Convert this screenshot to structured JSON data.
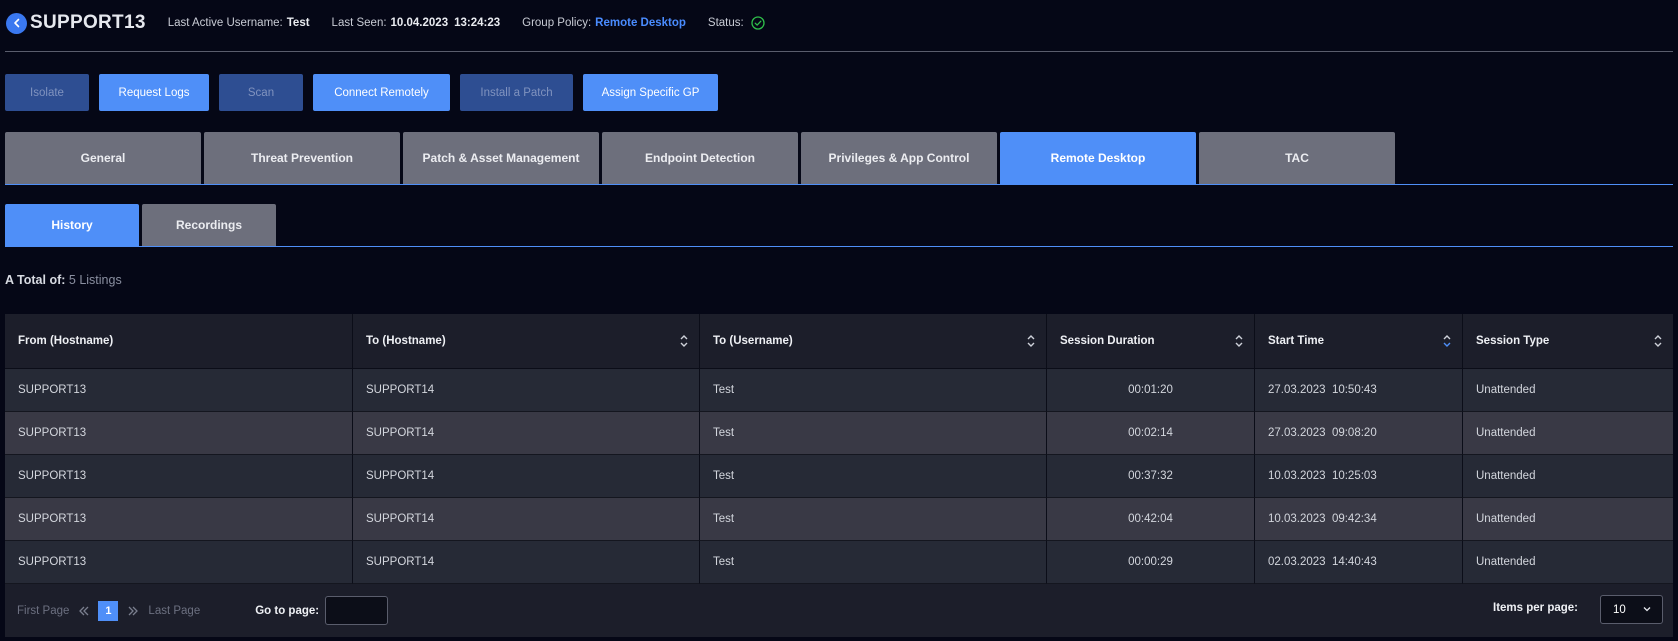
{
  "header": {
    "hostname": "SUPPORT13",
    "last_active_label": "Last Active Username:",
    "last_active_value": "Test",
    "last_seen_label": "Last Seen:",
    "last_seen_date": "10.04.2023",
    "last_seen_time": "13:24:23",
    "group_policy_label": "Group Policy:",
    "group_policy_value": "Remote Desktop",
    "status_label": "Status:",
    "status_icon": "check-circle-icon"
  },
  "actions": [
    {
      "label": "Isolate",
      "enabled": false
    },
    {
      "label": "Request Logs",
      "enabled": true
    },
    {
      "label": "Scan",
      "enabled": false
    },
    {
      "label": "Connect Remotely",
      "enabled": true
    },
    {
      "label": "Install a Patch",
      "enabled": false
    },
    {
      "label": "Assign Specific GP",
      "enabled": true
    }
  ],
  "tabs": [
    "General",
    "Threat Prevention",
    "Patch & Asset Management",
    "Endpoint Detection",
    "Privileges & App Control",
    "Remote Desktop",
    "TAC"
  ],
  "active_tab": "Remote Desktop",
  "subtabs": [
    "History",
    "Recordings"
  ],
  "active_subtab": "History",
  "total": {
    "label": "A Total of:",
    "count": "5 Listings"
  },
  "table": {
    "columns": [
      "From (Hostname)",
      "To (Hostname)",
      "To (Username)",
      "Session Duration",
      "Start Time",
      "Session Type"
    ],
    "rows": [
      [
        "SUPPORT13",
        "SUPPORT14",
        "Test",
        "00:01:20",
        "27.03.2023  10:50:43",
        "Unattended"
      ],
      [
        "SUPPORT13",
        "SUPPORT14",
        "Test",
        "00:02:14",
        "27.03.2023  09:08:20",
        "Unattended"
      ],
      [
        "SUPPORT13",
        "SUPPORT14",
        "Test",
        "00:37:32",
        "10.03.2023  10:25:03",
        "Unattended"
      ],
      [
        "SUPPORT13",
        "SUPPORT14",
        "Test",
        "00:42:04",
        "10.03.2023  09:42:34",
        "Unattended"
      ],
      [
        "SUPPORT13",
        "SUPPORT14",
        "Test",
        "00:00:29",
        "02.03.2023  14:40:43",
        "Unattended"
      ]
    ]
  },
  "pagination": {
    "first_label": "First Page",
    "last_label": "Last Page",
    "current_page": "1",
    "goto_label": "Go to page:",
    "goto_value": "",
    "items_per_page_label": "Items per page:",
    "items_per_page_value": "10"
  },
  "colors": {
    "accent": "#4f8ff8",
    "background": "#050716",
    "status_ok": "#2fbf4a"
  }
}
